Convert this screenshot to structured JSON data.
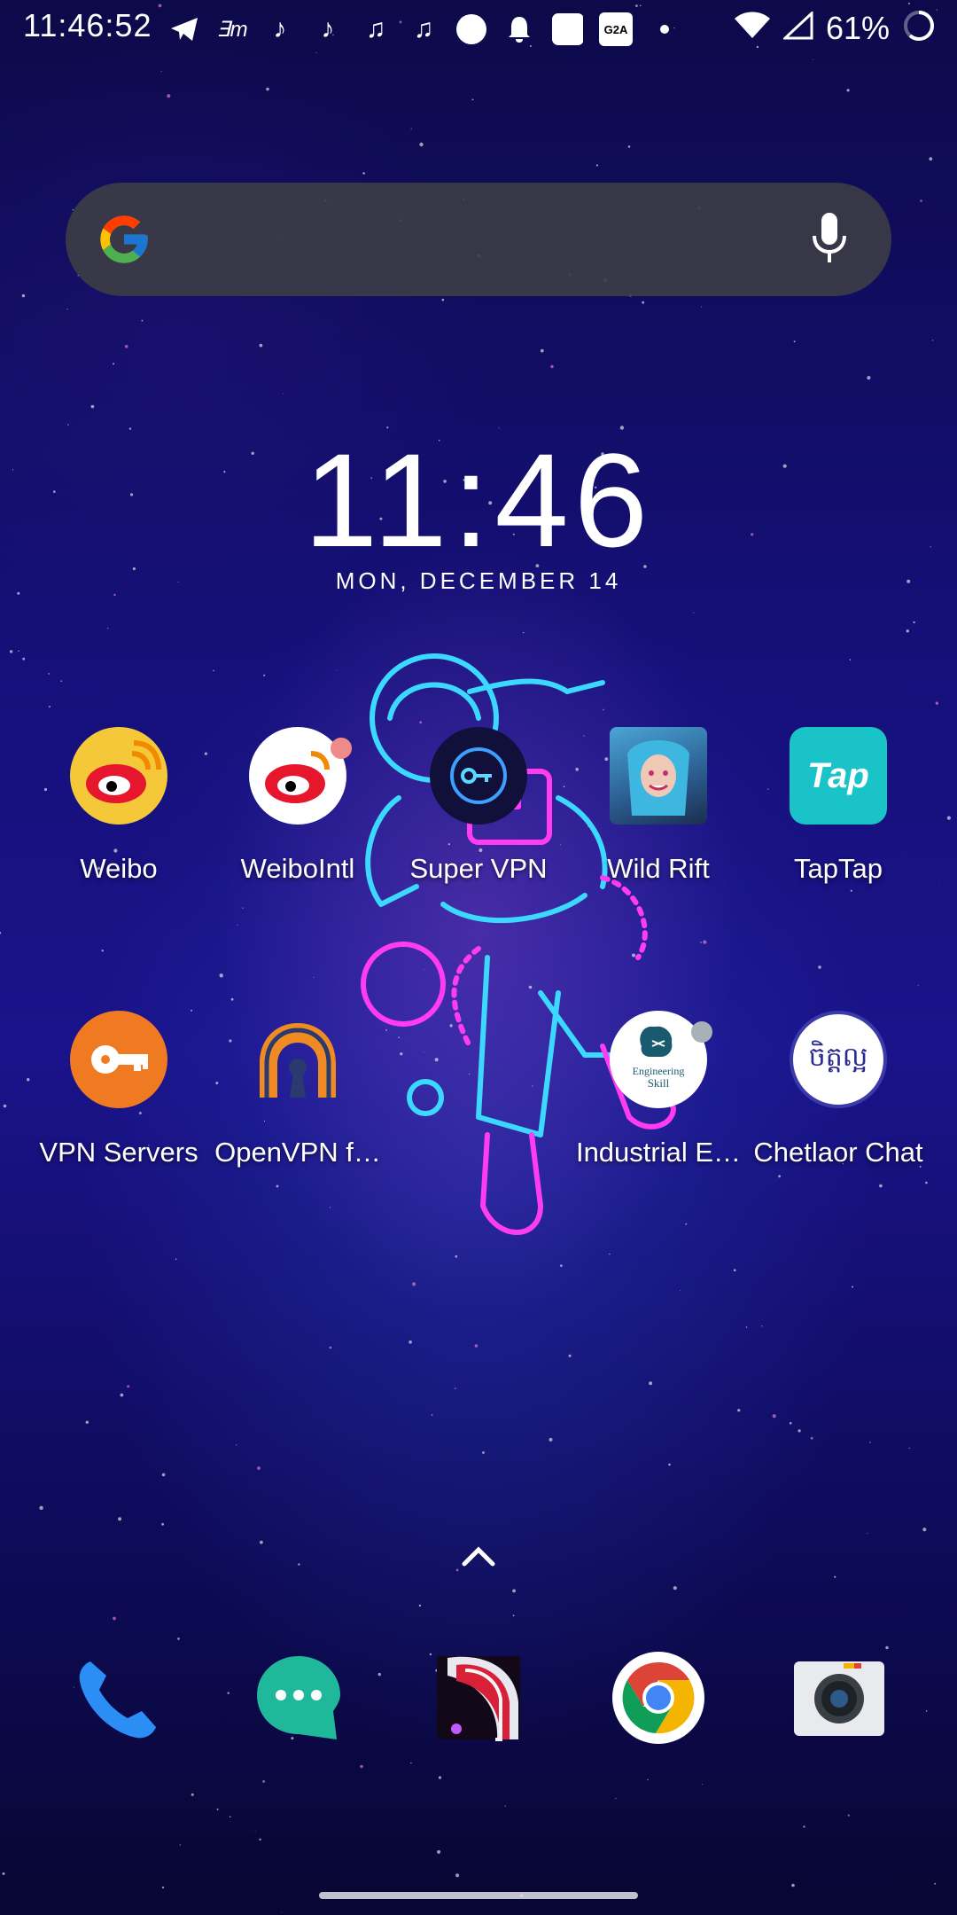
{
  "status_bar": {
    "time": "11:46:52",
    "notification_icons": [
      "telegram-icon",
      "em-app-icon",
      "tiktok-icon",
      "tiktok-icon",
      "music-note-icon",
      "music-note-icon",
      "circle-icon",
      "bell-icon",
      "square-icon",
      "g2a-icon",
      "dot-icon"
    ],
    "g2a_text": "G2A",
    "battery_percent": "61%"
  },
  "search_bar": {
    "logo": "google-g-logo",
    "voice_icon": "mic-icon"
  },
  "clock_widget": {
    "time": "11:46",
    "date": "MON, DECEMBER 14"
  },
  "apps_row1": [
    {
      "label": "Weibo"
    },
    {
      "label": "WeiboIntl"
    },
    {
      "label": "Super VPN"
    },
    {
      "label": "Wild Rift"
    },
    {
      "label": "TapTap"
    }
  ],
  "apps_row2": [
    {
      "label": "VPN Servers"
    },
    {
      "label": "OpenVPN f…"
    },
    {
      "label": "Industrial E…"
    },
    {
      "label": "Chetlaor Chat"
    }
  ],
  "tile_text": {
    "taptap": "Tap",
    "engineering": "Engineering",
    "skill": "Skill",
    "chetlaor": "ចិត្តល្អ"
  },
  "dock": [
    "phone-icon",
    "messages-icon",
    "game-icon",
    "chrome-icon",
    "camera-icon"
  ],
  "colors": {
    "accent_pink": "#ff3cf0",
    "accent_cyan": "#3cd8ff"
  }
}
